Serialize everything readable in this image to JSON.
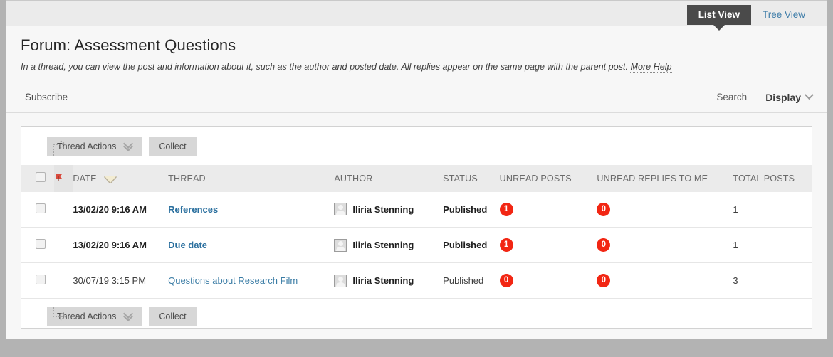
{
  "viewbar": {
    "tabs": [
      {
        "label": "List View",
        "active": true
      },
      {
        "label": "Tree View",
        "active": false
      }
    ]
  },
  "header": {
    "title": "Forum: Assessment Questions",
    "description": "In a thread, you can view the post and information about it, such as the author and posted date. All replies appear on the same page with the parent post.",
    "more_help_label": "More Help"
  },
  "actionbar": {
    "subscribe_label": "Subscribe",
    "search_label": "Search",
    "display_label": "Display"
  },
  "toolbar": {
    "thread_actions_label": "Thread Actions",
    "collect_label": "Collect"
  },
  "table": {
    "columns": {
      "date": "DATE",
      "thread": "THREAD",
      "author": "AUTHOR",
      "status": "STATUS",
      "unread_posts": "UNREAD POSTS",
      "unread_replies": "UNREAD REPLIES TO ME",
      "total_posts": "TOTAL POSTS"
    },
    "sort": {
      "column": "DATE",
      "direction": "descending"
    },
    "rows": [
      {
        "date": "13/02/20 9:16 AM",
        "thread": "References",
        "author": "Iliria Stenning",
        "status": "Published",
        "unread_posts": "1",
        "unread_replies": "0",
        "total_posts": "1",
        "unread": true
      },
      {
        "date": "13/02/20 9:16 AM",
        "thread": "Due date",
        "author": "Iliria Stenning",
        "status": "Published",
        "unread_posts": "1",
        "unread_replies": "0",
        "total_posts": "1",
        "unread": true
      },
      {
        "date": "30/07/19 3:15 PM",
        "thread": "Questions about Research Film",
        "author": "Iliria Stenning",
        "status": "Published",
        "unread_posts": "0",
        "unread_replies": "0",
        "total_posts": "3",
        "unread": false
      }
    ]
  },
  "colors": {
    "active_tab_bg": "#4a4a4a",
    "link": "#3a7ca5",
    "badge_red": "#f22613",
    "sort_triangle": "#f3ecd2"
  }
}
